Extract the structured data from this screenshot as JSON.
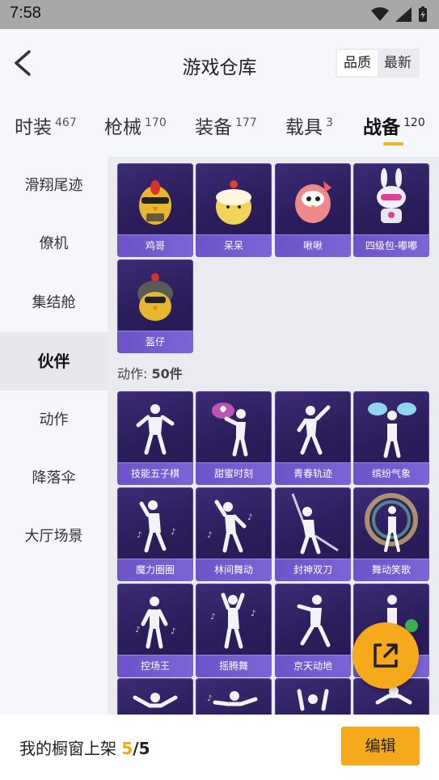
{
  "status": {
    "time": "7:58"
  },
  "header": {
    "title": "游戏仓库",
    "sort_options": [
      "品质",
      "最新"
    ]
  },
  "tabs": [
    {
      "label": "时装",
      "count": "467"
    },
    {
      "label": "枪械",
      "count": "170"
    },
    {
      "label": "装备",
      "count": "177"
    },
    {
      "label": "载具",
      "count": "3"
    },
    {
      "label": "战备",
      "count": "120"
    }
  ],
  "sidebar": [
    "滑翔尾迹",
    "僚机",
    "集结舱",
    "伙伴",
    "动作",
    "降落伞",
    "大厅场景"
  ],
  "partners": [
    "鸡哥",
    "呆呆",
    "啾啾",
    "四级包-嘟嘟",
    "盔仔"
  ],
  "actions_section": {
    "prefix": "动作: ",
    "count": "50件"
  },
  "actions": [
    "技能五子棋",
    "甜蜜时刻",
    "青春轨迹",
    "缤纷气象",
    "魔力圈圈",
    "林间舞动",
    "封神双刀",
    "舞动笑歌",
    "控场王",
    "摇腾舞",
    "京天动地",
    ""
  ],
  "bottom": {
    "text": "我的橱窗上架 ",
    "count": "5",
    "total": "/5",
    "edit_label": "编辑"
  },
  "colors": {
    "accent": "#f5a91b",
    "card_bg": "#2b1e5b",
    "card_label": "#7460d0"
  }
}
